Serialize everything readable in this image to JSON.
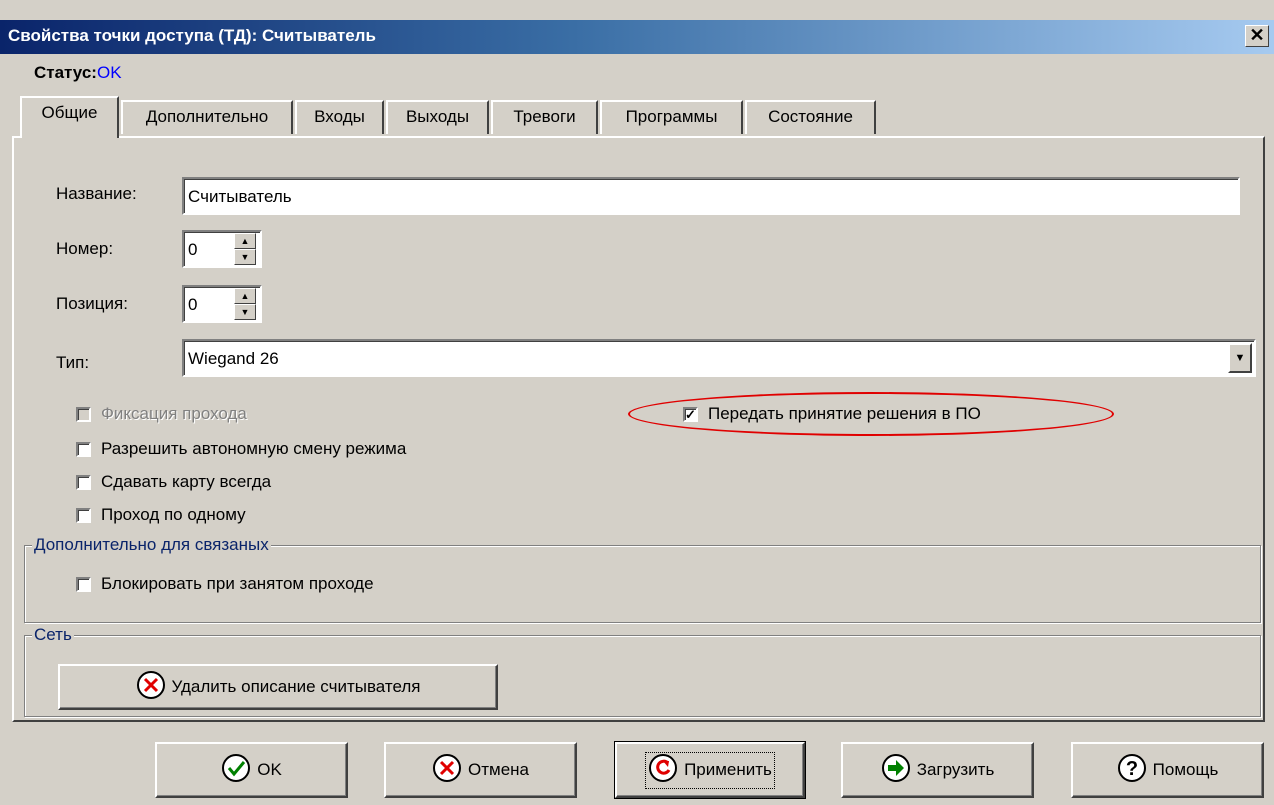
{
  "window": {
    "title": "Свойства точки доступа (ТД): Считыватель",
    "close_symbol": "✕"
  },
  "status": {
    "label": "Статус:",
    "value": "OK"
  },
  "tabs": [
    {
      "label": "Общие",
      "active": true
    },
    {
      "label": "Дополнительно",
      "active": false
    },
    {
      "label": "Входы",
      "active": false
    },
    {
      "label": "Выходы",
      "active": false
    },
    {
      "label": "Тревоги",
      "active": false
    },
    {
      "label": "Программы",
      "active": false
    },
    {
      "label": "Состояние",
      "active": false
    }
  ],
  "form": {
    "name_label": "Название:",
    "name_value": "Считыватель",
    "number_label": "Номер:",
    "number_value": "0",
    "position_label": "Позиция:",
    "position_value": "0",
    "type_label": "Тип:",
    "type_value": "Wiegand 26"
  },
  "checkboxes": {
    "fix_pass": {
      "label": "Фиксация прохода",
      "checked": false,
      "disabled": true
    },
    "autonomous": {
      "label": "Разрешить автономную смену режима",
      "checked": false
    },
    "card_always": {
      "label": "Сдавать карту всегда",
      "checked": false
    },
    "one_by_one": {
      "label": "Проход по одному",
      "checked": false
    },
    "transfer_decision": {
      "label": "Передать принятие решения в ПО",
      "checked": true
    }
  },
  "linked_group": {
    "title": "Дополнительно для  связаных",
    "block_label": "Блокировать  при занятом проходе",
    "block_checked": false
  },
  "network_group": {
    "title": "Сеть",
    "delete_button": "Удалить описание считывателя"
  },
  "buttons": {
    "ok": "OK",
    "cancel": "Отмена",
    "apply": "Применить",
    "load": "Загрузить",
    "help": "Помощь"
  },
  "colors": {
    "status_ok": "#0000ff",
    "annotation": "#e00000",
    "title_start": "#0a246a"
  }
}
